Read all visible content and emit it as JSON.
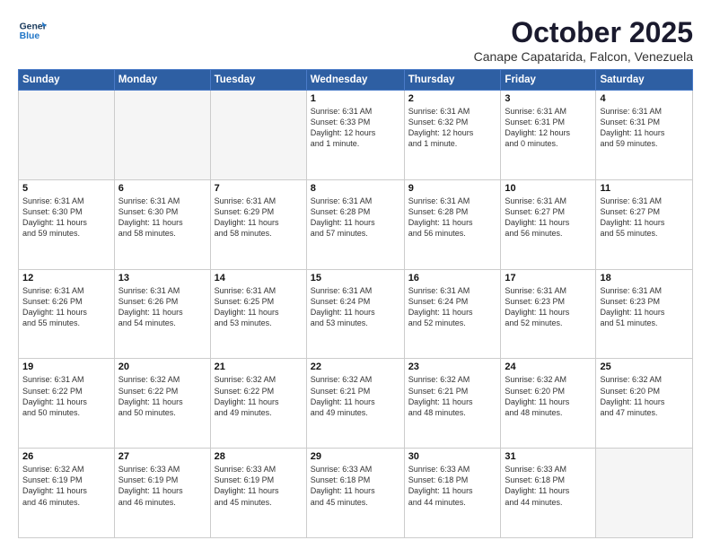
{
  "header": {
    "logo_line1": "General",
    "logo_line2": "Blue",
    "month": "October 2025",
    "location": "Canape Capatarida, Falcon, Venezuela"
  },
  "days_of_week": [
    "Sunday",
    "Monday",
    "Tuesday",
    "Wednesday",
    "Thursday",
    "Friday",
    "Saturday"
  ],
  "weeks": [
    [
      {
        "day": "",
        "info": ""
      },
      {
        "day": "",
        "info": ""
      },
      {
        "day": "",
        "info": ""
      },
      {
        "day": "1",
        "info": "Sunrise: 6:31 AM\nSunset: 6:33 PM\nDaylight: 12 hours\nand 1 minute."
      },
      {
        "day": "2",
        "info": "Sunrise: 6:31 AM\nSunset: 6:32 PM\nDaylight: 12 hours\nand 1 minute."
      },
      {
        "day": "3",
        "info": "Sunrise: 6:31 AM\nSunset: 6:31 PM\nDaylight: 12 hours\nand 0 minutes."
      },
      {
        "day": "4",
        "info": "Sunrise: 6:31 AM\nSunset: 6:31 PM\nDaylight: 11 hours\nand 59 minutes."
      }
    ],
    [
      {
        "day": "5",
        "info": "Sunrise: 6:31 AM\nSunset: 6:30 PM\nDaylight: 11 hours\nand 59 minutes."
      },
      {
        "day": "6",
        "info": "Sunrise: 6:31 AM\nSunset: 6:30 PM\nDaylight: 11 hours\nand 58 minutes."
      },
      {
        "day": "7",
        "info": "Sunrise: 6:31 AM\nSunset: 6:29 PM\nDaylight: 11 hours\nand 58 minutes."
      },
      {
        "day": "8",
        "info": "Sunrise: 6:31 AM\nSunset: 6:28 PM\nDaylight: 11 hours\nand 57 minutes."
      },
      {
        "day": "9",
        "info": "Sunrise: 6:31 AM\nSunset: 6:28 PM\nDaylight: 11 hours\nand 56 minutes."
      },
      {
        "day": "10",
        "info": "Sunrise: 6:31 AM\nSunset: 6:27 PM\nDaylight: 11 hours\nand 56 minutes."
      },
      {
        "day": "11",
        "info": "Sunrise: 6:31 AM\nSunset: 6:27 PM\nDaylight: 11 hours\nand 55 minutes."
      }
    ],
    [
      {
        "day": "12",
        "info": "Sunrise: 6:31 AM\nSunset: 6:26 PM\nDaylight: 11 hours\nand 55 minutes."
      },
      {
        "day": "13",
        "info": "Sunrise: 6:31 AM\nSunset: 6:26 PM\nDaylight: 11 hours\nand 54 minutes."
      },
      {
        "day": "14",
        "info": "Sunrise: 6:31 AM\nSunset: 6:25 PM\nDaylight: 11 hours\nand 53 minutes."
      },
      {
        "day": "15",
        "info": "Sunrise: 6:31 AM\nSunset: 6:24 PM\nDaylight: 11 hours\nand 53 minutes."
      },
      {
        "day": "16",
        "info": "Sunrise: 6:31 AM\nSunset: 6:24 PM\nDaylight: 11 hours\nand 52 minutes."
      },
      {
        "day": "17",
        "info": "Sunrise: 6:31 AM\nSunset: 6:23 PM\nDaylight: 11 hours\nand 52 minutes."
      },
      {
        "day": "18",
        "info": "Sunrise: 6:31 AM\nSunset: 6:23 PM\nDaylight: 11 hours\nand 51 minutes."
      }
    ],
    [
      {
        "day": "19",
        "info": "Sunrise: 6:31 AM\nSunset: 6:22 PM\nDaylight: 11 hours\nand 50 minutes."
      },
      {
        "day": "20",
        "info": "Sunrise: 6:32 AM\nSunset: 6:22 PM\nDaylight: 11 hours\nand 50 minutes."
      },
      {
        "day": "21",
        "info": "Sunrise: 6:32 AM\nSunset: 6:22 PM\nDaylight: 11 hours\nand 49 minutes."
      },
      {
        "day": "22",
        "info": "Sunrise: 6:32 AM\nSunset: 6:21 PM\nDaylight: 11 hours\nand 49 minutes."
      },
      {
        "day": "23",
        "info": "Sunrise: 6:32 AM\nSunset: 6:21 PM\nDaylight: 11 hours\nand 48 minutes."
      },
      {
        "day": "24",
        "info": "Sunrise: 6:32 AM\nSunset: 6:20 PM\nDaylight: 11 hours\nand 48 minutes."
      },
      {
        "day": "25",
        "info": "Sunrise: 6:32 AM\nSunset: 6:20 PM\nDaylight: 11 hours\nand 47 minutes."
      }
    ],
    [
      {
        "day": "26",
        "info": "Sunrise: 6:32 AM\nSunset: 6:19 PM\nDaylight: 11 hours\nand 46 minutes."
      },
      {
        "day": "27",
        "info": "Sunrise: 6:33 AM\nSunset: 6:19 PM\nDaylight: 11 hours\nand 46 minutes."
      },
      {
        "day": "28",
        "info": "Sunrise: 6:33 AM\nSunset: 6:19 PM\nDaylight: 11 hours\nand 45 minutes."
      },
      {
        "day": "29",
        "info": "Sunrise: 6:33 AM\nSunset: 6:18 PM\nDaylight: 11 hours\nand 45 minutes."
      },
      {
        "day": "30",
        "info": "Sunrise: 6:33 AM\nSunset: 6:18 PM\nDaylight: 11 hours\nand 44 minutes."
      },
      {
        "day": "31",
        "info": "Sunrise: 6:33 AM\nSunset: 6:18 PM\nDaylight: 11 hours\nand 44 minutes."
      },
      {
        "day": "",
        "info": ""
      }
    ]
  ]
}
